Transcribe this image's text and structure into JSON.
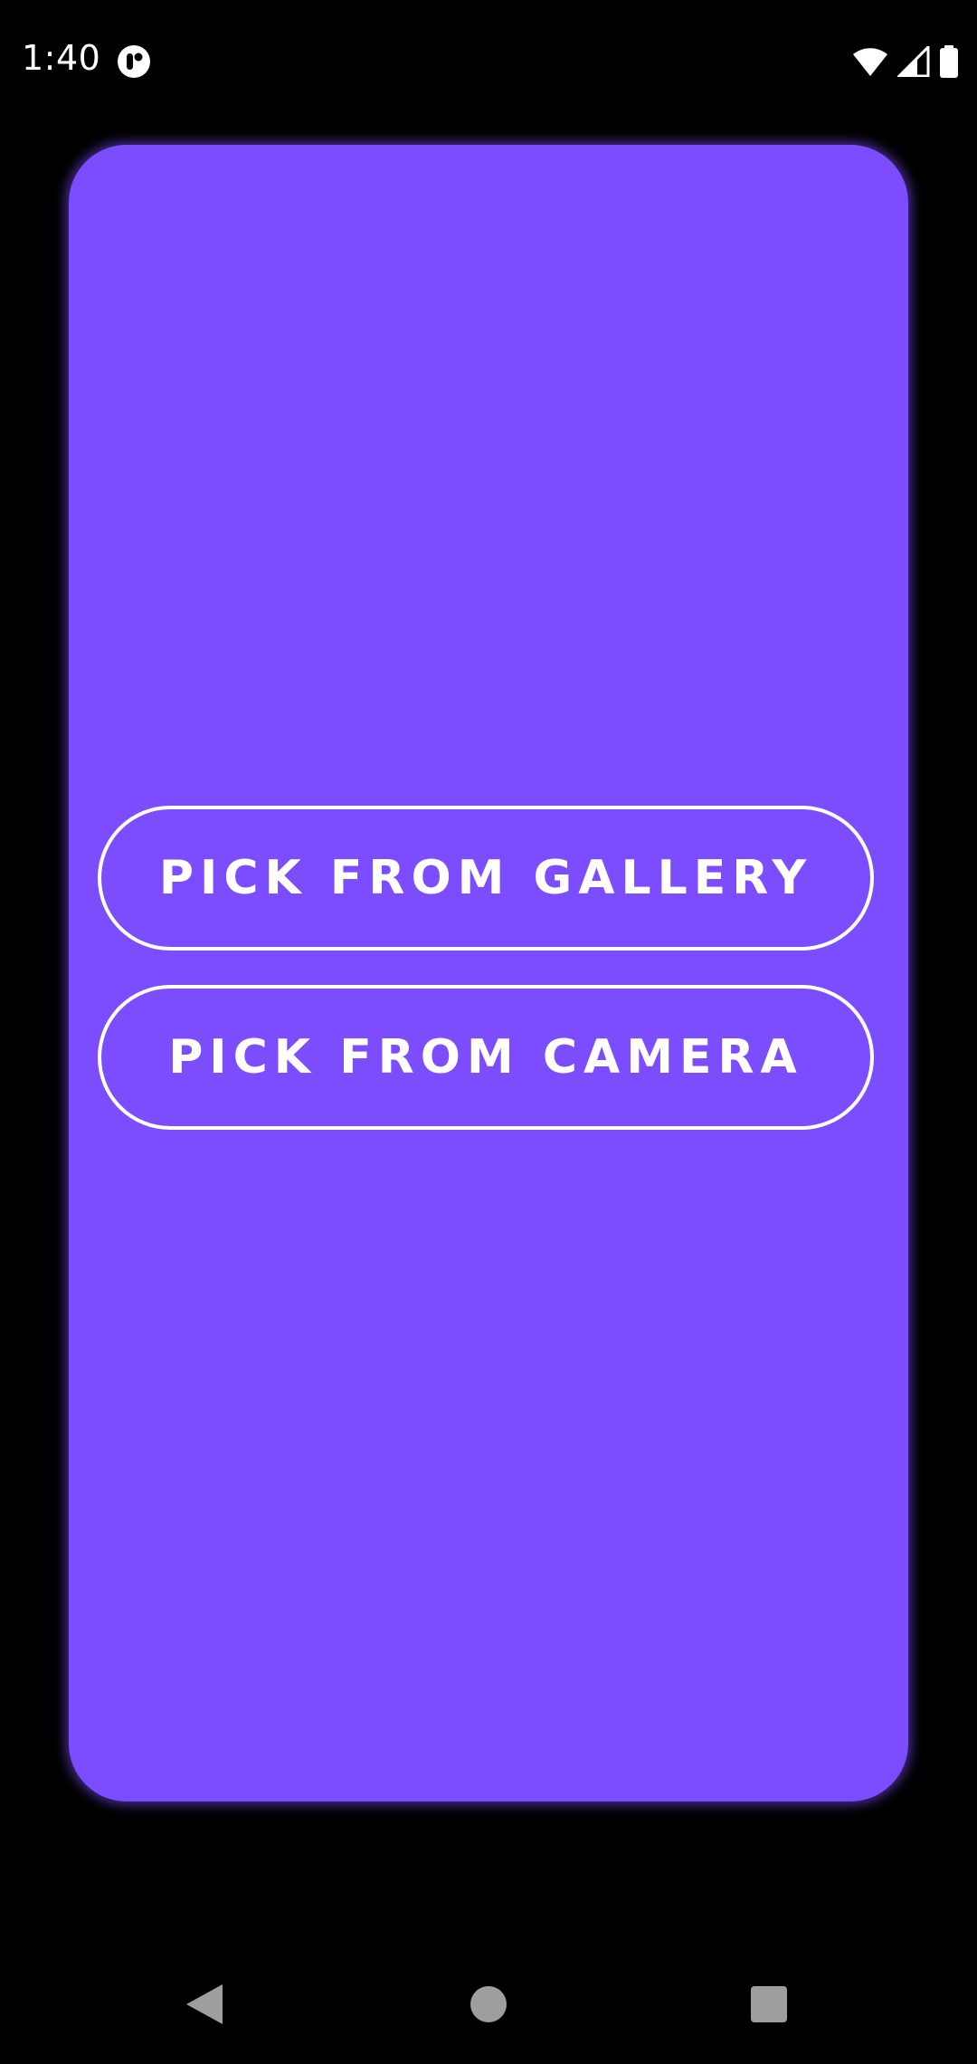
{
  "status_bar": {
    "time": "1:40",
    "icons": [
      "notification-app-icon",
      "wifi-icon",
      "cell-signal-icon",
      "battery-icon"
    ]
  },
  "card": {
    "background_color": "#7c4dff",
    "buttons": {
      "gallery_label": "PICK FROM GALLERY",
      "camera_label": "PICK FROM CAMERA"
    }
  },
  "nav_bar": {
    "icons": [
      "back-icon",
      "home-icon",
      "recents-icon"
    ]
  }
}
